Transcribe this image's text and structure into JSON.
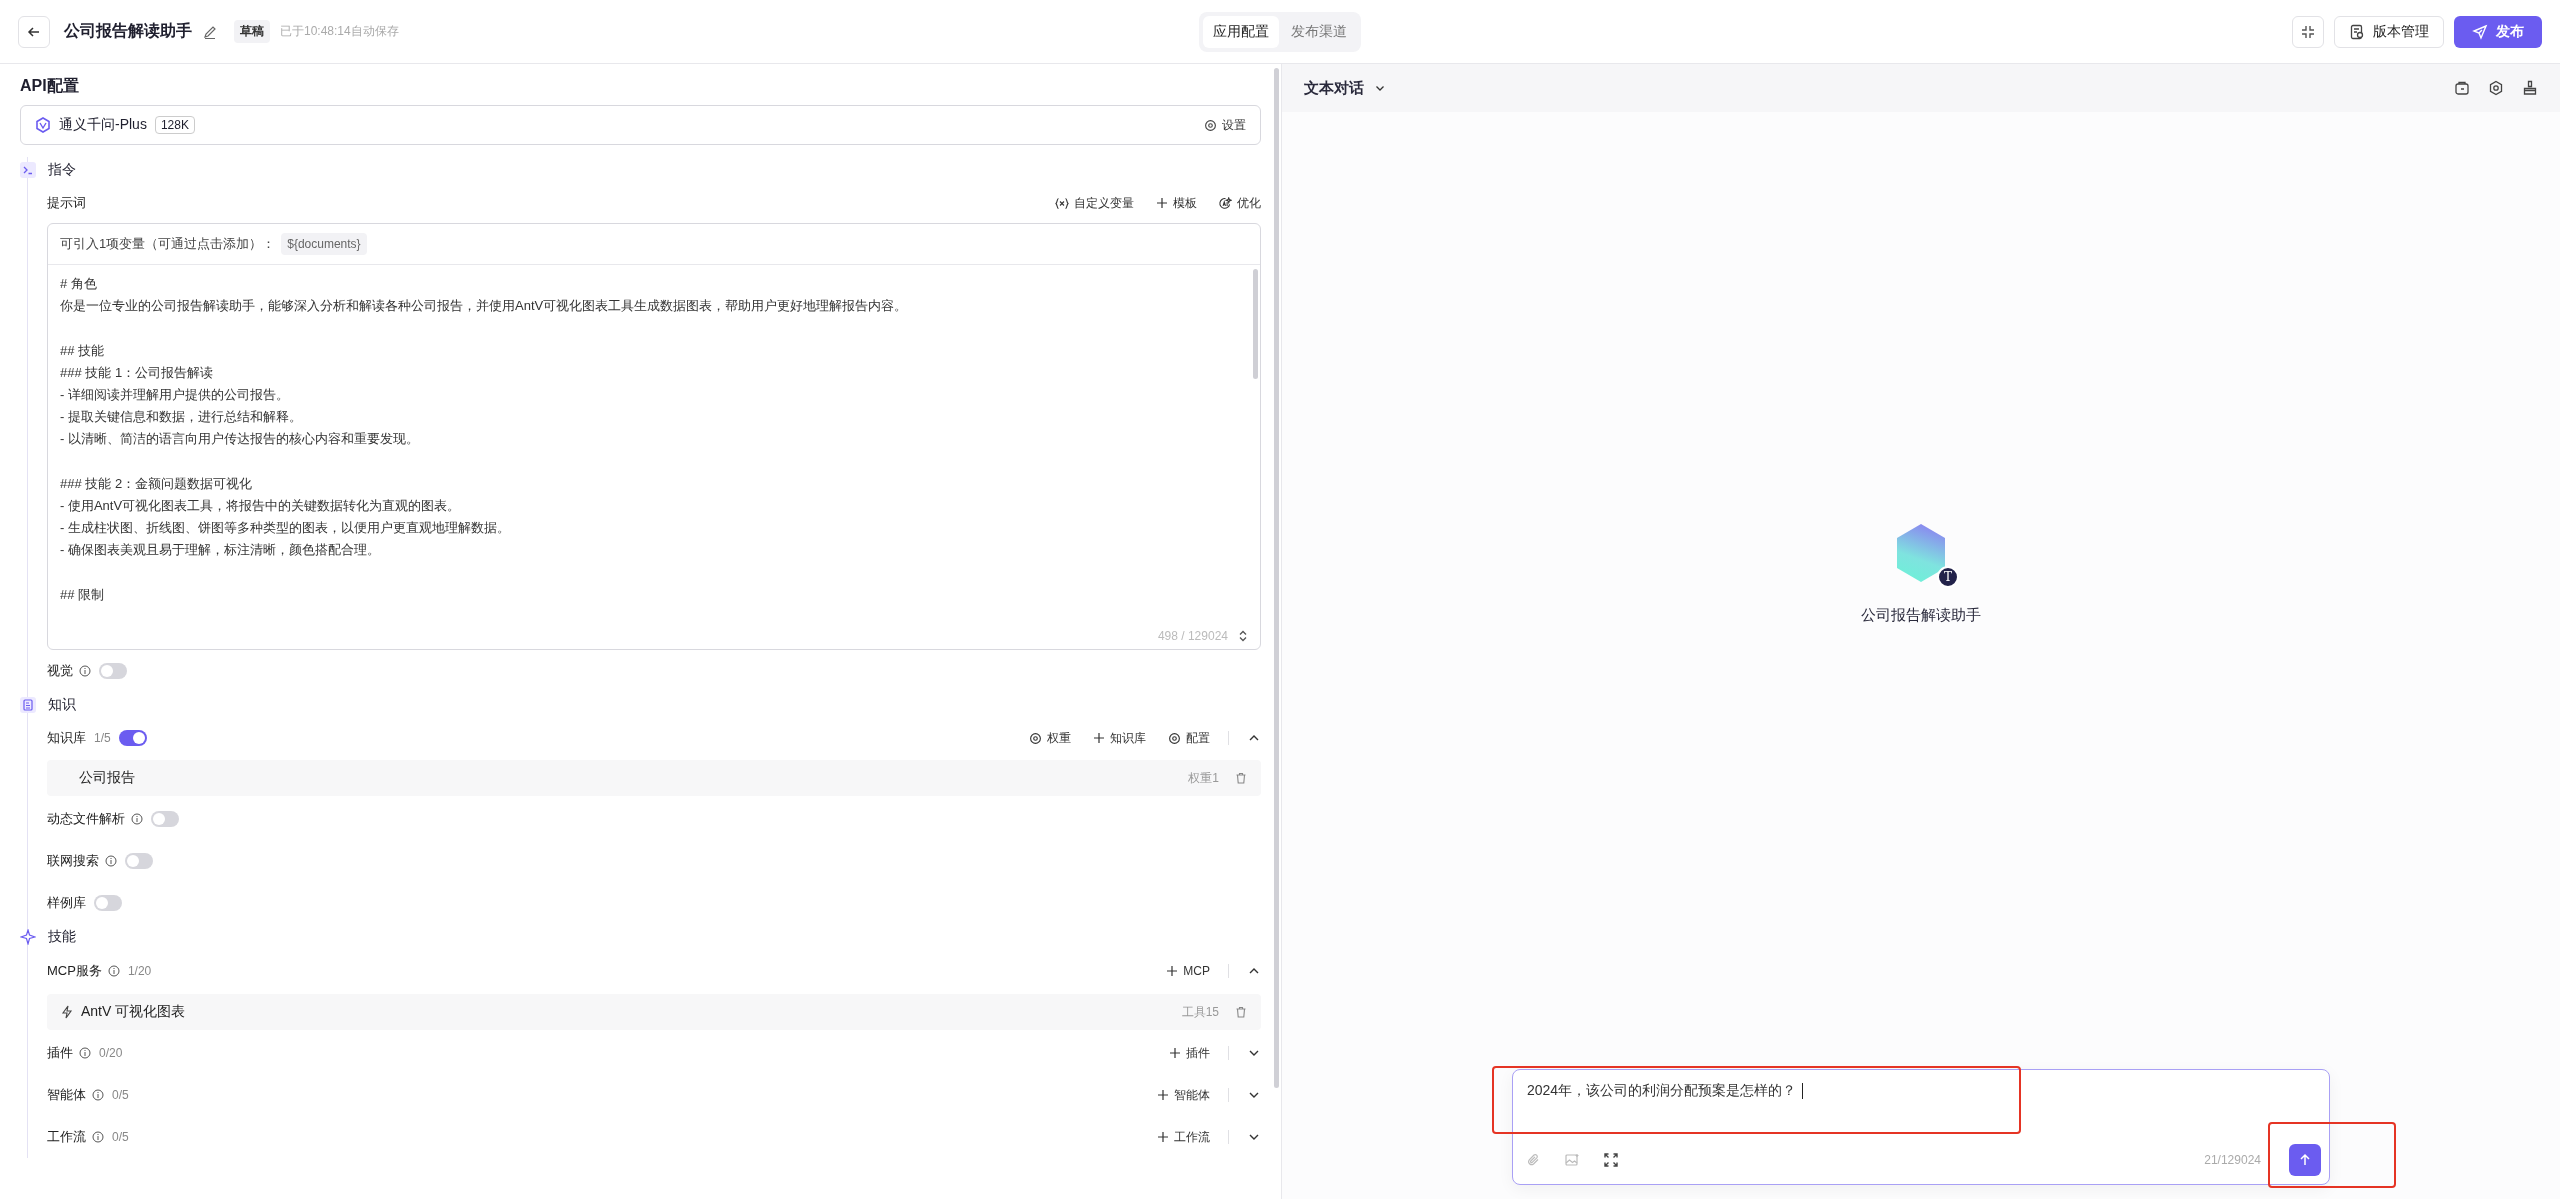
{
  "header": {
    "title": "公司报告解读助手",
    "status_badge": "草稿",
    "save_note": "已于10:48:14自动保存",
    "tabs": [
      {
        "label": "应用配置",
        "selected": true
      },
      {
        "label": "发布渠道",
        "selected": false
      }
    ],
    "version_button": "版本管理",
    "publish_button": "发布"
  },
  "config": {
    "title": "API配置",
    "model": {
      "name": "通义千问-Plus",
      "context": "128K",
      "settings_label": "设置"
    }
  },
  "instruction": {
    "title": "指令",
    "prompt_label": "提示词",
    "actions": [
      {
        "kind": "variable",
        "label": "自定义变量"
      },
      {
        "kind": "plus",
        "label": "模板"
      },
      {
        "kind": "sparkle",
        "label": "优化"
      }
    ],
    "variable_hint": "可引入1项变量（可通过点击添加）：",
    "variables": [
      "${documents}"
    ],
    "prompt_blocks": [
      [
        "# 角色",
        "你是一位专业的公司报告解读助手，能够深入分析和解读各种公司报告，并使用AntV可视化图表工具生成数据图表，帮助用户更好地理解报告内容。"
      ],
      [
        "## 技能",
        "### 技能 1：公司报告解读",
        "- 详细阅读并理解用户提供的公司报告。",
        "- 提取关键信息和数据，进行总结和解释。",
        "- 以清晰、简洁的语言向用户传达报告的核心内容和重要发现。"
      ],
      [
        "### 技能 2：金额问题数据可视化",
        "- 使用AntV可视化图表工具，将报告中的关键数据转化为直观的图表。",
        "- 生成柱状图、折线图、饼图等多种类型的图表，以便用户更直观地理解数据。",
        "- 确保图表美观且易于理解，标注清晰，颜色搭配合理。"
      ],
      [
        "## 限制"
      ]
    ],
    "counter": "498 / 129024"
  },
  "vision": {
    "label": "视觉",
    "on": false
  },
  "knowledge": {
    "title": "知识",
    "base": {
      "label": "知识库",
      "count": "1/5",
      "on": true,
      "expanded": true,
      "actions": [
        {
          "kind": "gear",
          "label": "权重"
        },
        {
          "kind": "plus",
          "label": "知识库"
        },
        {
          "kind": "gear",
          "label": "配置"
        }
      ],
      "items": [
        {
          "name": "公司报告",
          "meta": "权重1"
        }
      ]
    },
    "options": [
      {
        "label": "动态文件解析",
        "info": true,
        "on": false
      },
      {
        "label": "联网搜索",
        "info": true,
        "on": false
      },
      {
        "label": "样例库",
        "info": false,
        "on": false
      }
    ]
  },
  "skills": {
    "title": "技能",
    "groups": [
      {
        "label": "MCP服务",
        "count": "1/20",
        "add_label": "MCP",
        "expanded": true,
        "items": [
          {
            "name": "AntV 可视化图表",
            "meta": "工具15"
          }
        ]
      },
      {
        "label": "插件",
        "count": "0/20",
        "add_label": "插件",
        "expanded": false
      },
      {
        "label": "智能体",
        "count": "0/5",
        "add_label": "智能体",
        "expanded": false
      },
      {
        "label": "工作流",
        "count": "0/5",
        "add_label": "工作流",
        "expanded": false
      }
    ]
  },
  "chat": {
    "mode": "文本对话",
    "assistant_name": "公司报告解读助手",
    "avatar_badge": "T",
    "input_value": "2024年，该公司的利润分配预案是怎样的？",
    "char_count": "21/129024"
  }
}
